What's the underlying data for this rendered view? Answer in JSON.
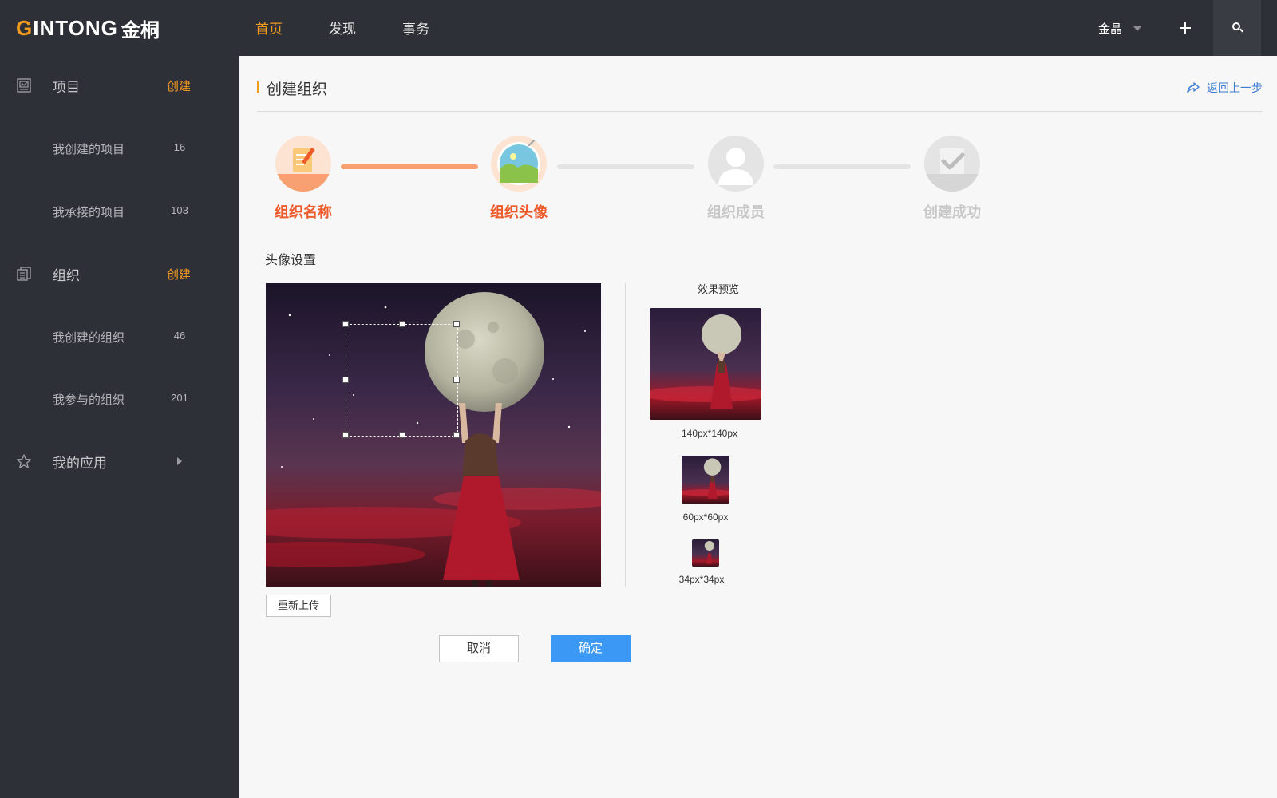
{
  "header": {
    "logo_letter": "G",
    "logo_text": "INTONG",
    "logo_cn": "金桐",
    "nav": [
      {
        "label": "首页",
        "active": true
      },
      {
        "label": "发现",
        "active": false
      },
      {
        "label": "事务",
        "active": false
      }
    ],
    "user_name": "金晶",
    "icons": {
      "add": "plus-icon",
      "search": "search-icon",
      "user_menu": "caret-down-icon"
    }
  },
  "sidebar": {
    "projects": {
      "label": "项目",
      "create": "创建",
      "icon": "project-icon",
      "items": [
        {
          "label": "我创建的项目",
          "count": "16"
        },
        {
          "label": "我承接的项目",
          "count": "103"
        }
      ]
    },
    "orgs": {
      "label": "组织",
      "create": "创建",
      "icon": "organization-icon",
      "items": [
        {
          "label": "我创建的组织",
          "count": "46"
        },
        {
          "label": "我参与的组织",
          "count": "201"
        }
      ]
    },
    "apps": {
      "label": "我的应用",
      "icon": "star-icon"
    }
  },
  "page": {
    "title": "创建组织",
    "back": "返回上一步"
  },
  "steps": [
    {
      "label": "组织名称",
      "state": "done",
      "icon": "document-pencil-icon"
    },
    {
      "label": "组织头像",
      "state": "current",
      "icon": "image-icon"
    },
    {
      "label": "组织成员",
      "state": "todo",
      "icon": "user-icon"
    },
    {
      "label": "创建成功",
      "state": "todo",
      "icon": "checkmark-icon"
    }
  ],
  "avatar": {
    "section_label": "头像设置",
    "preview_title": "效果预览",
    "sizes": [
      "140px*140px",
      "60px*60px",
      "34px*34px"
    ],
    "reupload": "重新上传",
    "cancel": "取消",
    "confirm": "确定"
  },
  "colors": {
    "accent": "#f19a1f",
    "step_active": "#ee5b2b",
    "primary_button": "#3c98f5",
    "dark_bg": "#2e3037"
  }
}
